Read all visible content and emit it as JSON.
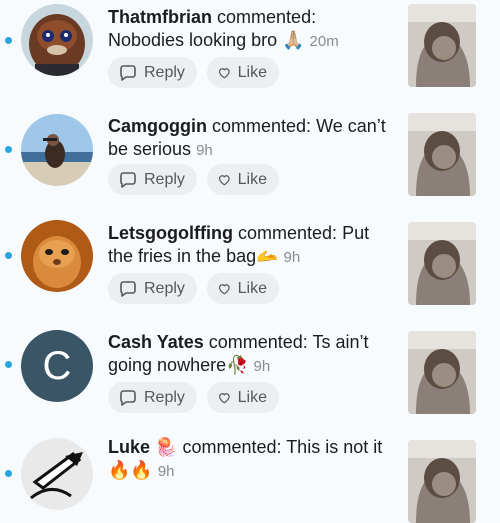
{
  "comments": [
    {
      "user": "Thatmfbrian",
      "action": "commented:",
      "text": "Nobodies looking bro 🙏🏼",
      "time": "20m",
      "avatar": "character-avatar"
    },
    {
      "user": "Camgoggin",
      "action": "commented:",
      "text": "We can’t be serious",
      "time": "9h",
      "avatar": "beach-avatar"
    },
    {
      "user": "Letsgogolffing",
      "action": "commented:",
      "text": "Put the fries in the bag🫴",
      "time": "9h",
      "avatar": "cat-avatar"
    },
    {
      "user": "Cash Yates",
      "action": "commented:",
      "text": "Ts ain’t going nowhere🥀",
      "time": "9h",
      "avatar": "C"
    },
    {
      "user": "Luke 🪼",
      "action": "commented:",
      "text": "This is not it 🔥🔥",
      "time": "9h",
      "avatar": "drawing-avatar"
    }
  ],
  "actions": {
    "reply_label": "Reply",
    "like_label": "Like"
  },
  "colors": {
    "unread_dot": "#26a6e0",
    "button_bg": "#eceef0",
    "time_gray": "#8a8a8e"
  }
}
